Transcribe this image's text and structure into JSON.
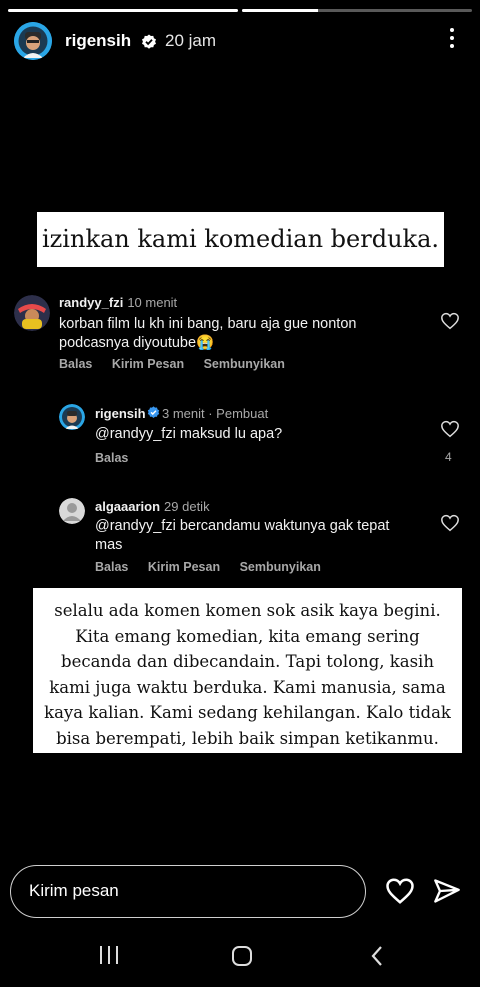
{
  "story": {
    "progress": [
      1.0,
      0.33
    ],
    "username": "rigensih",
    "time": "20 jam",
    "title": "izinkan kami komedian berduka.",
    "quote_lines": [
      "selalu ada komen komen sok asik kaya begini.",
      "Kita emang komedian, kita emang sering",
      "becanda dan dibecandain. Tapi tolong, kasih",
      "kami juga waktu berduka. Kami manusia, sama",
      "kaya kalian. Kami sedang kehilangan. Kalo tidak",
      "bisa berempati, lebih baik simpan ketikanmu."
    ]
  },
  "comments": [
    {
      "username": "randyy_fzi",
      "time": "10 menit",
      "text_line1": "korban film lu kh ini bang, baru aja gue nonton",
      "text_line2": "podcasnya diyoutube😭",
      "actions": [
        "Balas",
        "Kirim Pesan",
        "Sembunyikan"
      ]
    },
    {
      "username": "rigensih",
      "time": "3 menit · Pembuat",
      "text_line1": "@randyy_fzi maksud lu apa?",
      "actions": [
        "Balas"
      ],
      "likes": "4"
    },
    {
      "username": "algaaarion",
      "time": "29 detik",
      "text_line1": "@randyy_fzi bercandamu waktunya gak tepat",
      "text_line2": "mas",
      "actions": [
        "Balas",
        "Kirim Pesan",
        "Sembunyikan"
      ]
    }
  ],
  "bottom": {
    "message_placeholder": "Kirim pesan"
  },
  "icons": {
    "verified": "verified-badge-icon",
    "more": "more-vertical-icon",
    "heart": "heart-outline-icon",
    "send": "paper-plane-icon",
    "nav_recent": "recent-apps-icon",
    "nav_home": "home-icon",
    "nav_back": "back-icon"
  }
}
